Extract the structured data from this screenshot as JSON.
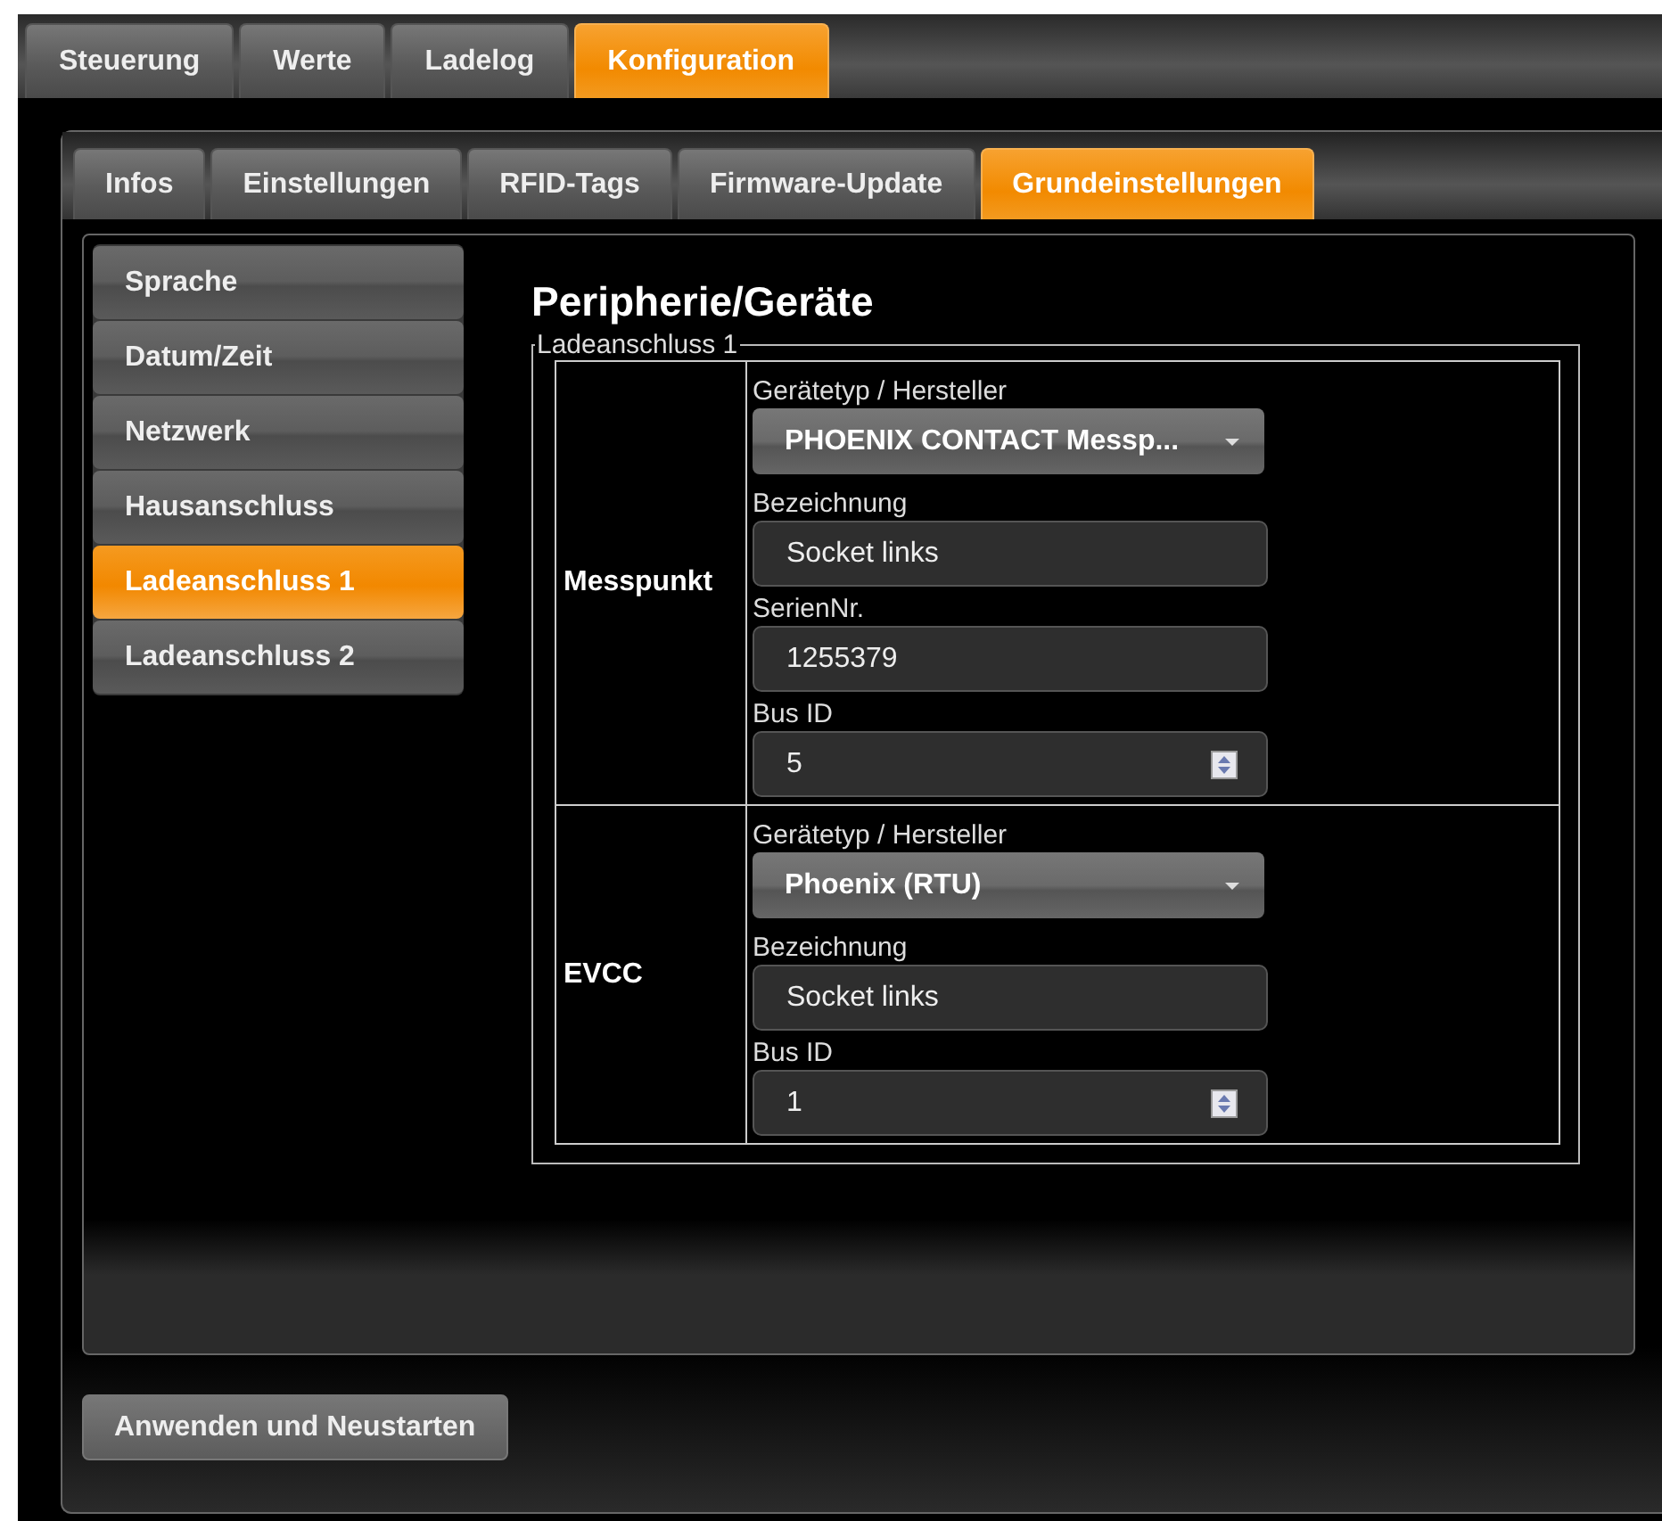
{
  "top_tabs": [
    {
      "label": "Steuerung",
      "selected": false
    },
    {
      "label": "Werte",
      "selected": false
    },
    {
      "label": "Ladelog",
      "selected": false
    },
    {
      "label": "Konfiguration",
      "selected": true
    }
  ],
  "sub_tabs": [
    {
      "label": "Infos",
      "selected": false
    },
    {
      "label": "Einstellungen",
      "selected": false
    },
    {
      "label": "RFID-Tags",
      "selected": false
    },
    {
      "label": "Firmware-Update",
      "selected": false
    },
    {
      "label": "Grundeinstellungen",
      "selected": true
    }
  ],
  "sidebar": {
    "items": [
      {
        "label": "Sprache",
        "selected": false
      },
      {
        "label": "Datum/Zeit",
        "selected": false
      },
      {
        "label": "Netzwerk",
        "selected": false
      },
      {
        "label": "Hausanschluss",
        "selected": false
      },
      {
        "label": "Ladeanschluss 1",
        "selected": true
      },
      {
        "label": "Ladeanschluss 2",
        "selected": false
      }
    ]
  },
  "section": {
    "title": "Peripherie/Geräte",
    "group": {
      "legend": "Ladeanschluss 1",
      "rows": [
        {
          "label": "Messpunkt",
          "fields": [
            {
              "kind": "select",
              "label": "Gerätetyp / Hersteller",
              "value": "PHOENIX CONTACT Messp..."
            },
            {
              "kind": "text",
              "label": "Bezeichnung",
              "value": "Socket links"
            },
            {
              "kind": "text",
              "label": "SerienNr.",
              "value": "1255379"
            },
            {
              "kind": "spin",
              "label": "Bus ID",
              "value": "5"
            }
          ]
        },
        {
          "label": "EVCC",
          "fields": [
            {
              "kind": "select",
              "label": "Gerätetyp / Hersteller",
              "value": "Phoenix (RTU)"
            },
            {
              "kind": "text",
              "label": "Bezeichnung",
              "value": "Socket links"
            },
            {
              "kind": "spin",
              "label": "Bus ID",
              "value": "1"
            }
          ]
        }
      ]
    }
  },
  "buttons": [
    "Anwenden und Neustarten"
  ]
}
